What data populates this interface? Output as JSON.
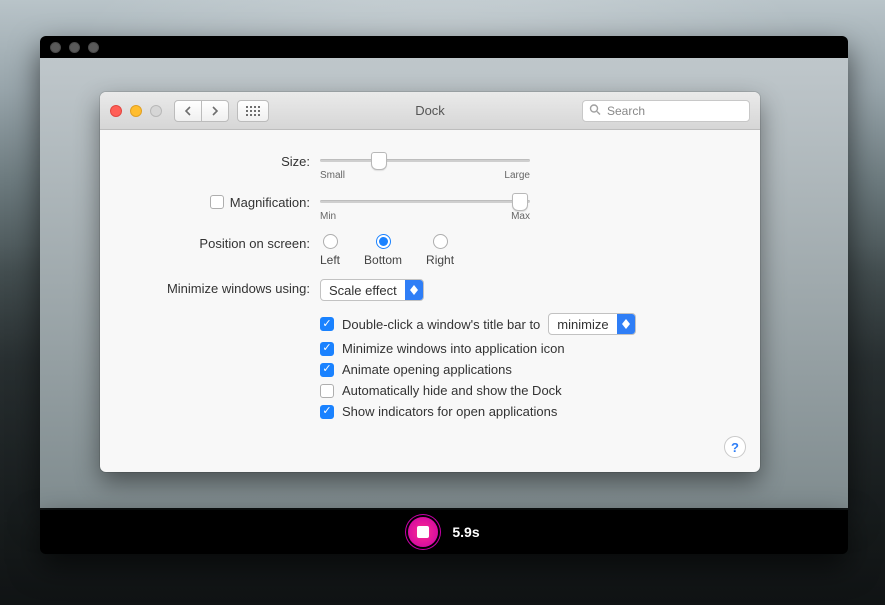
{
  "title": "Dock",
  "search_placeholder": "Search",
  "labels": {
    "size": "Size:",
    "size_min": "Small",
    "size_max": "Large",
    "magnification": "Magnification:",
    "mag_min": "Min",
    "mag_max": "Max",
    "position": "Position on screen:",
    "pos_left": "Left",
    "pos_bottom": "Bottom",
    "pos_right": "Right",
    "minimize_using": "Minimize windows using:"
  },
  "minimize_effect": "Scale effect",
  "options": {
    "dblclick_prefix": "Double-click a window's title bar to",
    "dblclick_action": "minimize",
    "minimize_into_icon": "Minimize windows into application icon",
    "animate_open": "Animate opening applications",
    "autohide": "Automatically hide and show the Dock",
    "indicators": "Show indicators for open applications"
  },
  "recording_time": "5.9s",
  "slider_size_pct": 28,
  "slider_mag_pct": 95,
  "checks": {
    "magnification": false,
    "dblclick": true,
    "minimize_into_icon": true,
    "animate_open": true,
    "autohide": false,
    "indicators": true
  },
  "position_selected": "bottom"
}
